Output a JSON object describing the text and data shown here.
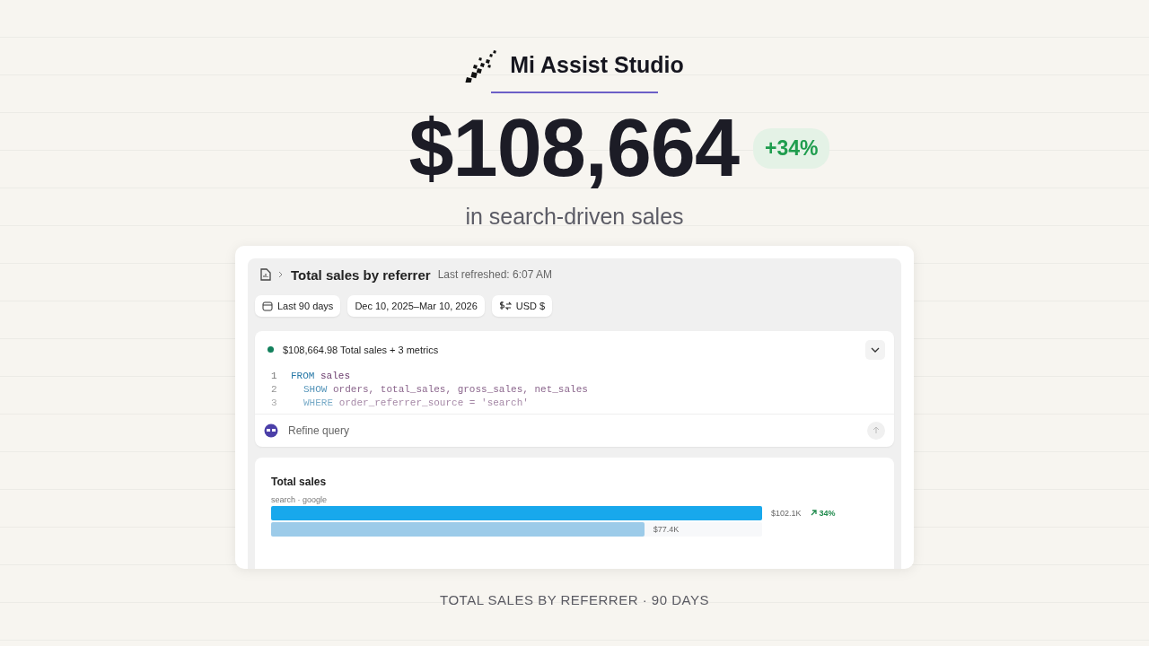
{
  "brand": {
    "name": "Mi Assist Studio"
  },
  "headline": {
    "amount": "$108,664",
    "change": "+34%",
    "caption": "in search-driven sales"
  },
  "report": {
    "title": "Total sales by referrer",
    "refreshed": "Last refreshed: 6:07 AM",
    "filters": [
      {
        "kind": "calendar",
        "label": "Last 90 days"
      },
      {
        "kind": "plain",
        "label": "Dec 10, 2025–Mar 10, 2026"
      },
      {
        "kind": "currency",
        "label": "USD $"
      }
    ],
    "query": {
      "summary": "$108,664.98 Total sales + 3 metrics",
      "expanded": true,
      "lines": [
        {
          "number": "1",
          "keyword": "FROM",
          "rest": "sales"
        },
        {
          "number": "2",
          "keyword": "SHOW",
          "rest": "orders, total_sales, gross_sales, net_sales"
        },
        {
          "number": "3",
          "keyword": "WHERE",
          "rest": "order_referrer_source = 'search'"
        }
      ],
      "refine_placeholder": "Refine query"
    },
    "chart": {
      "title": "Total sales",
      "subtitle": "search · google",
      "bars": [
        {
          "level": 1,
          "value": "$102.1K",
          "change": "34%",
          "color": "#18a8ec"
        },
        {
          "level": 0.76,
          "value": "$77.4K",
          "color": "#9ccbe9"
        }
      ]
    }
  },
  "footer": "TOTAL SALES BY REFERRER · 90 DAYS"
}
